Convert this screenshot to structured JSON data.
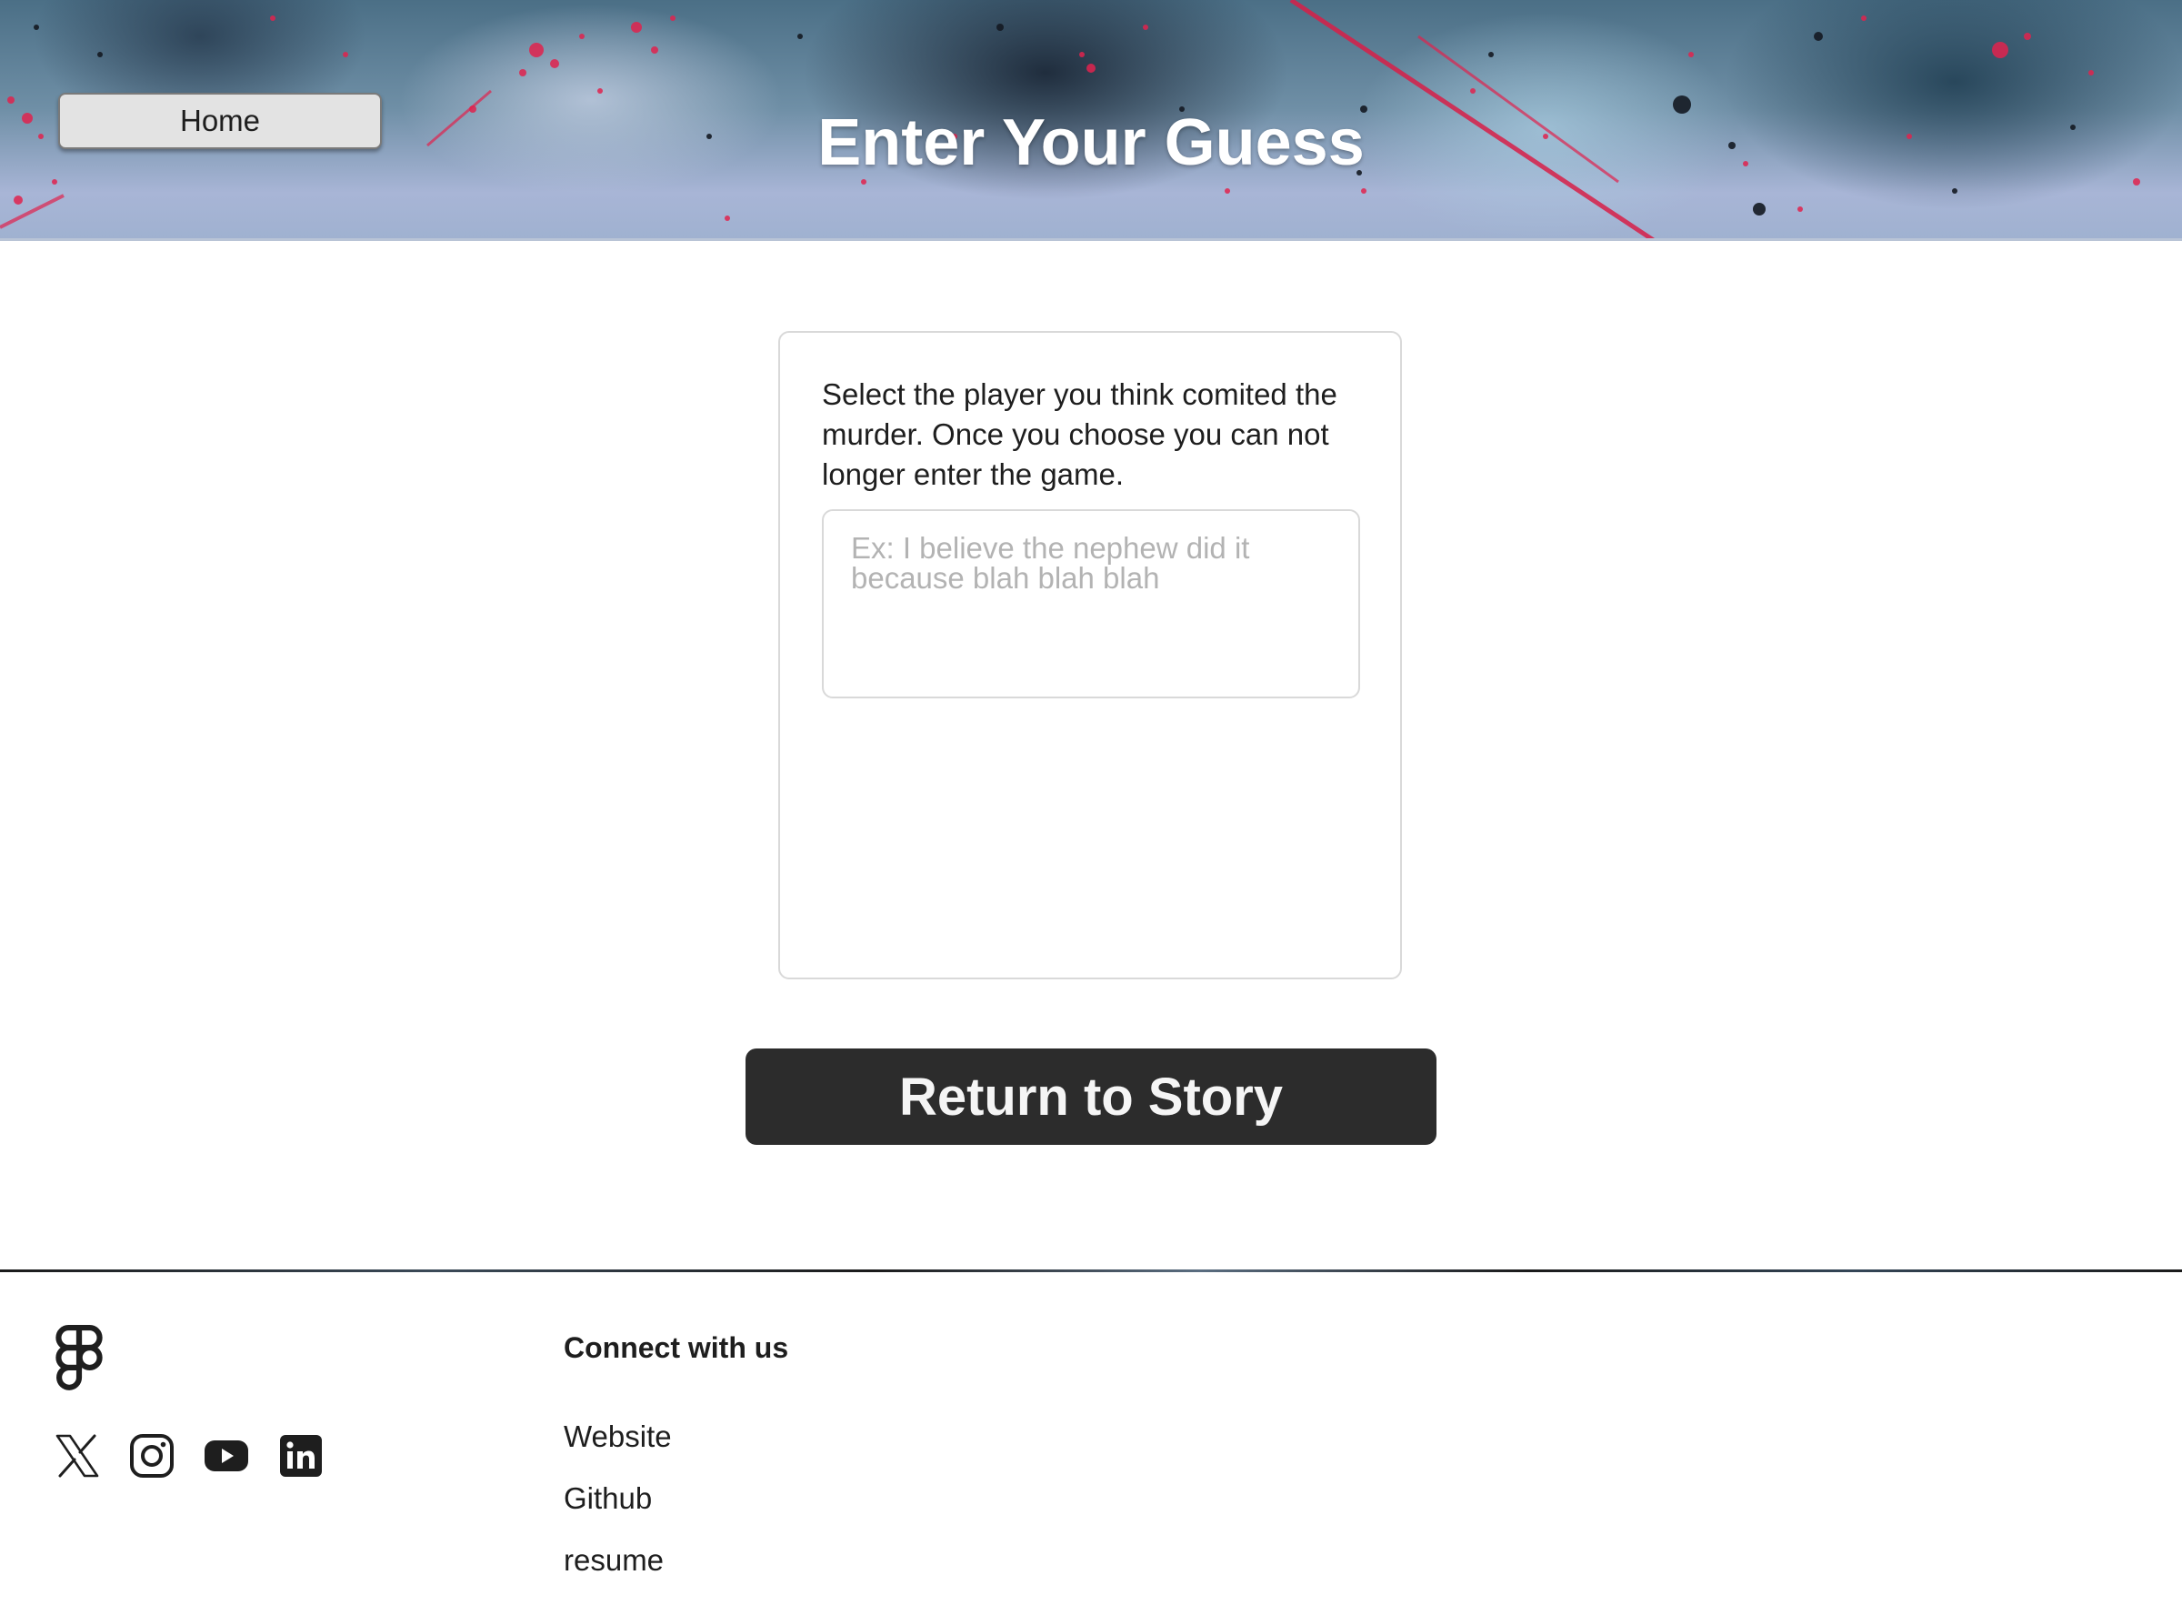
{
  "header": {
    "home_label": "Home",
    "title": "Enter Your Guess"
  },
  "card": {
    "instructions": "Select the player you think comited the murder. Once you choose you can not longer enter the game.",
    "guess_value": "",
    "guess_placeholder": "Ex: I believe the nephew did it because blah blah blah"
  },
  "return_button_label": "Return to Story",
  "footer": {
    "logo_icon": "figma-logo-icon",
    "social_icons": [
      "x-icon",
      "instagram-icon",
      "youtube-icon",
      "linkedin-icon"
    ],
    "heading": "Connect with us",
    "links": [
      "Website",
      "Github",
      "resume"
    ]
  },
  "colors": {
    "button_dark": "#2c2c2c",
    "home_button_bg": "#e3e3e3",
    "border_light": "#d9d9d9",
    "placeholder": "#b3b3b3",
    "splatter_red": "#e0234e"
  }
}
